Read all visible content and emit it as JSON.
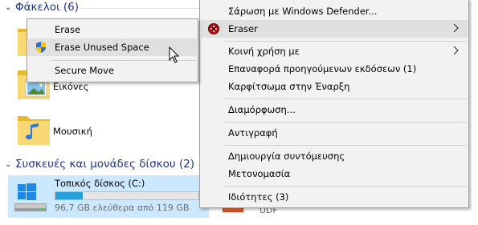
{
  "explorer": {
    "folders_group": {
      "title": "Φάκελοι (6)"
    },
    "folders": [
      {
        "label": "Εικόνες"
      },
      {
        "label": "Μουσική"
      }
    ],
    "devices_group": {
      "title": "Συσκευές και μονάδες δίσκου (2)"
    },
    "drive": {
      "name": "Τοπικός δίσκος (C:)",
      "free_text": "96,7 GB ελεύθερα από 119 GB",
      "used_fraction": 0.19
    },
    "second_drive": {
      "label": "UDF"
    }
  },
  "context_menu": {
    "items": [
      {
        "label": "Σάρωση με Windows Defender..."
      },
      {
        "label": "Eraser",
        "has_submenu": true,
        "icon": "eraser-icon"
      },
      {
        "label": "Κοινή χρήση με",
        "has_submenu": true
      },
      {
        "label": "Επαναφορά προηγούμενων εκδόσεων (1)"
      },
      {
        "label": "Καρφίτσωμα στην Έναρξη"
      },
      {
        "label": "Διαμόρφωση..."
      },
      {
        "label": "Αντιγραφή"
      },
      {
        "label": "Δημιουργία συντόμευσης"
      },
      {
        "label": "Μετονομασία"
      },
      {
        "label": "Ιδιότητες (3)"
      }
    ]
  },
  "eraser_submenu": {
    "items": [
      {
        "label": "Erase"
      },
      {
        "label": "Erase Unused Space",
        "icon": "uac-shield-icon"
      },
      {
        "label": "Secure Move"
      }
    ]
  },
  "colors": {
    "group_header": "#1e3287",
    "selection": "#cce8ff",
    "menu_background": "#f2f2f2",
    "menu_hover": "#e0e0e0",
    "drive_bar": "#26a0da"
  }
}
